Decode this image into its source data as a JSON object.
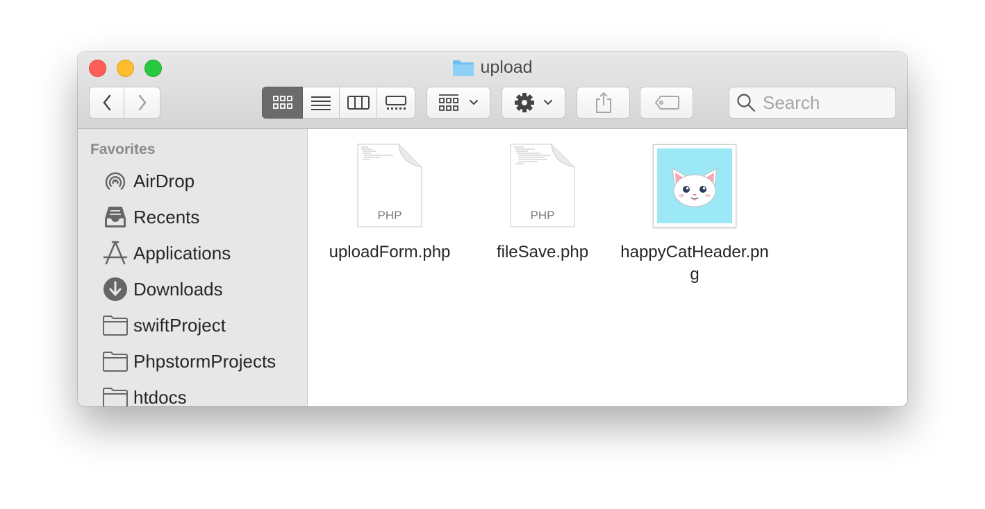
{
  "window": {
    "title": "upload"
  },
  "toolbar": {
    "search_placeholder": "Search",
    "icons": {
      "back": "chevron-left-icon",
      "forward": "chevron-right-icon",
      "icon_view": "grid-icon",
      "list_view": "list-icon",
      "column_view": "columns-icon",
      "gallery_view": "gallery-icon",
      "group": "group-icon",
      "action": "gear-icon",
      "share": "share-icon",
      "tag": "tag-icon",
      "search": "magnifier-icon"
    }
  },
  "sidebar": {
    "heading": "Favorites",
    "items": [
      {
        "label": "AirDrop",
        "icon": "airdrop-icon"
      },
      {
        "label": "Recents",
        "icon": "recents-icon"
      },
      {
        "label": "Applications",
        "icon": "applications-icon"
      },
      {
        "label": "Downloads",
        "icon": "downloads-icon"
      },
      {
        "label": "swiftProject",
        "icon": "folder-icon"
      },
      {
        "label": "PhpstormProjects",
        "icon": "folder-icon"
      },
      {
        "label": "htdocs",
        "icon": "folder-icon"
      }
    ]
  },
  "files": [
    {
      "name": "uploadForm.php",
      "type": "PHP"
    },
    {
      "name": "fileSave.php",
      "type": "PHP"
    },
    {
      "name": "happyCatHeader.png",
      "type": "image"
    }
  ],
  "colors": {
    "close": "#fe5f57",
    "minimize": "#febc2e",
    "maximize": "#28c840",
    "folder": "#6ec0f0",
    "image_bg": "#9de8f6"
  }
}
